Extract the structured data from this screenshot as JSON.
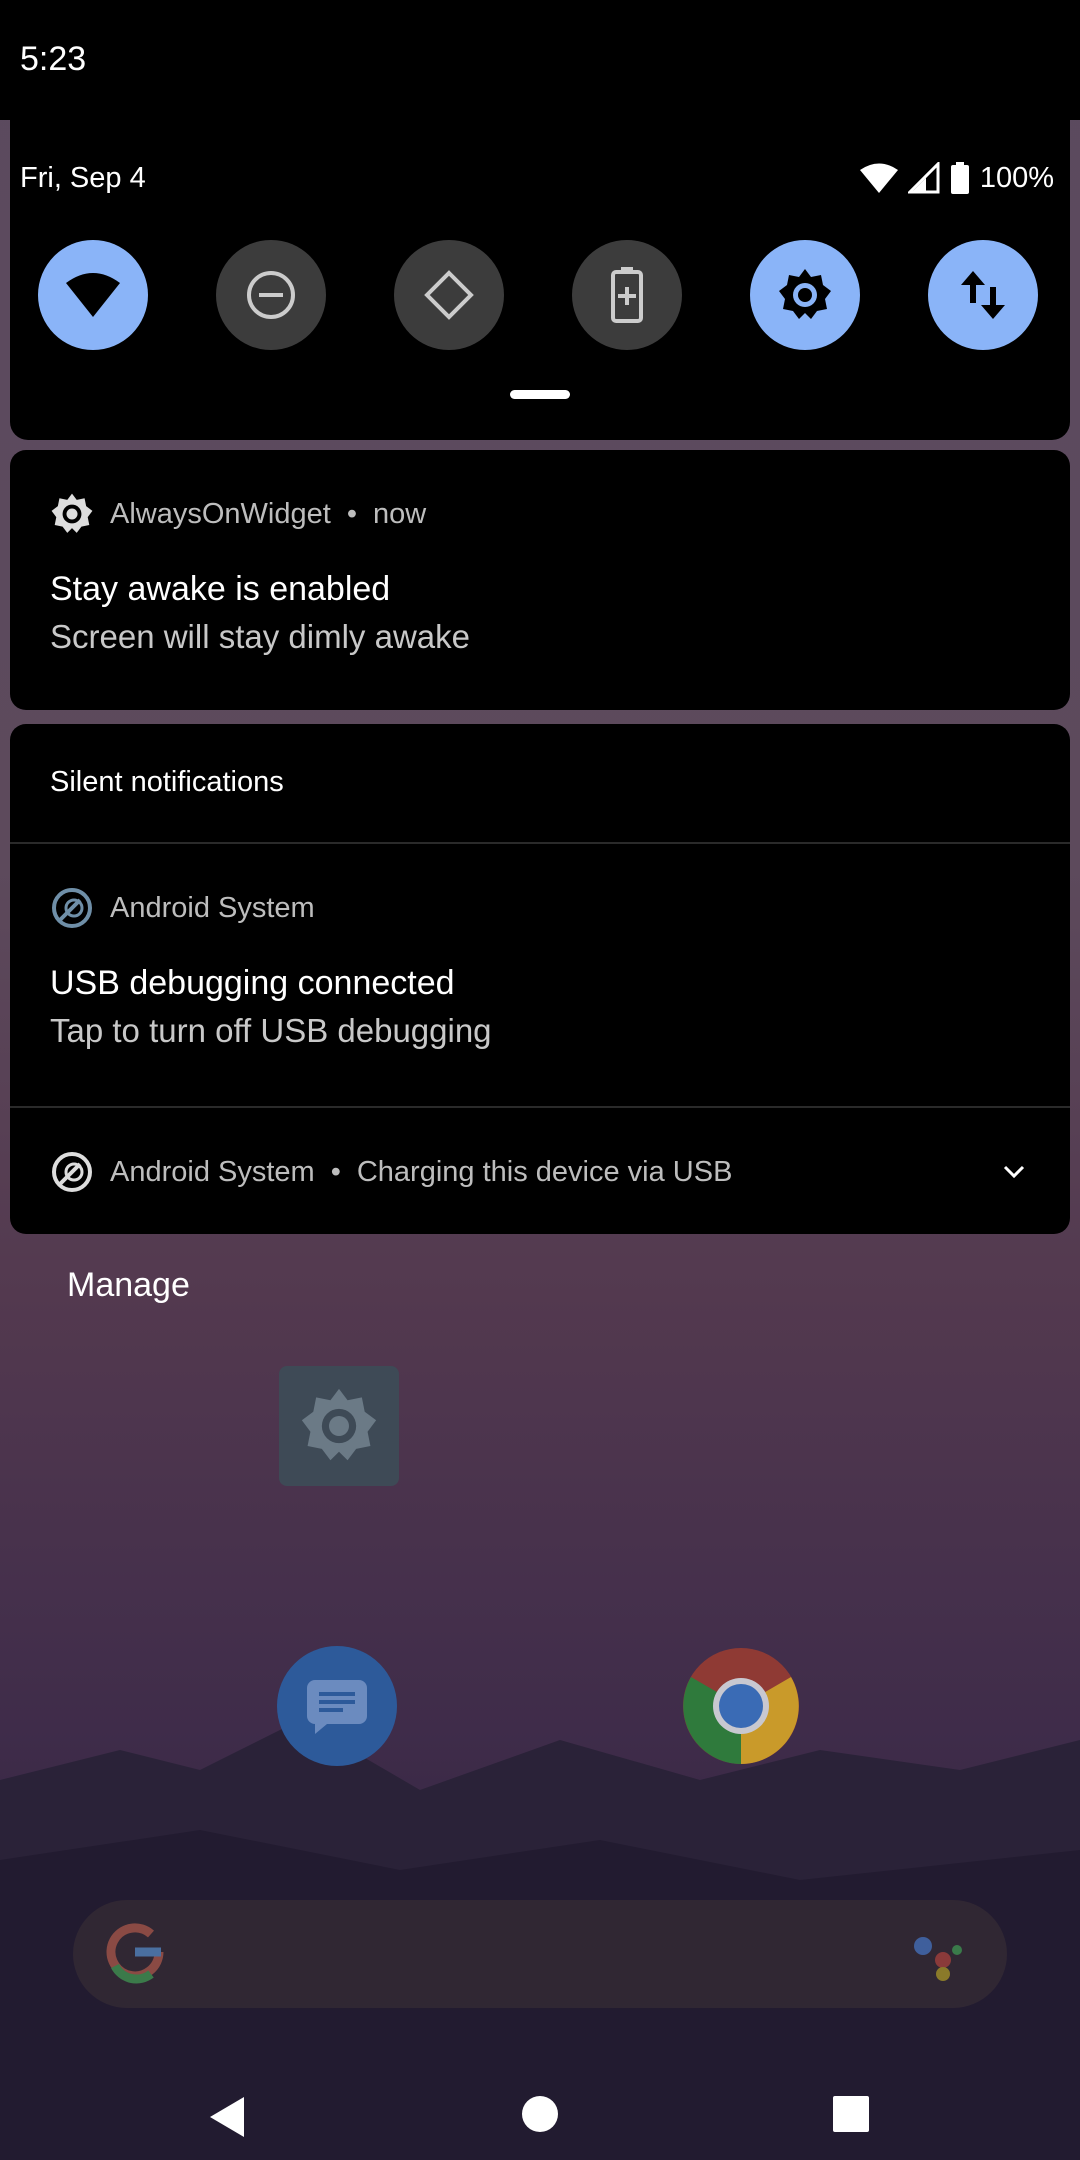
{
  "status_bar": {
    "time": "5:23"
  },
  "quick_settings": {
    "date": "Fri, Sep 4",
    "battery_percent": "100%",
    "tiles": [
      {
        "name": "wifi",
        "state": "on"
      },
      {
        "name": "do-not-disturb",
        "state": "off"
      },
      {
        "name": "auto-rotate",
        "state": "off"
      },
      {
        "name": "battery-saver",
        "state": "off"
      },
      {
        "name": "stay-awake",
        "state": "on"
      },
      {
        "name": "mobile-data",
        "state": "on"
      }
    ]
  },
  "notifications": {
    "awake": {
      "app": "AlwaysOnWidget",
      "time": "now",
      "title": "Stay awake is enabled",
      "text": "Screen will stay dimly awake"
    },
    "silent_header": "Silent notifications",
    "usb_debug": {
      "app": "Android System",
      "title": "USB debugging connected",
      "text": "Tap to turn off USB debugging"
    },
    "charging": {
      "app": "Android System",
      "summary": "Charging this device via USB"
    }
  },
  "manage_label": "Manage",
  "separator": "•",
  "colors": {
    "accent": "#8ab4f8",
    "tile_off": "#3c3c3c"
  }
}
